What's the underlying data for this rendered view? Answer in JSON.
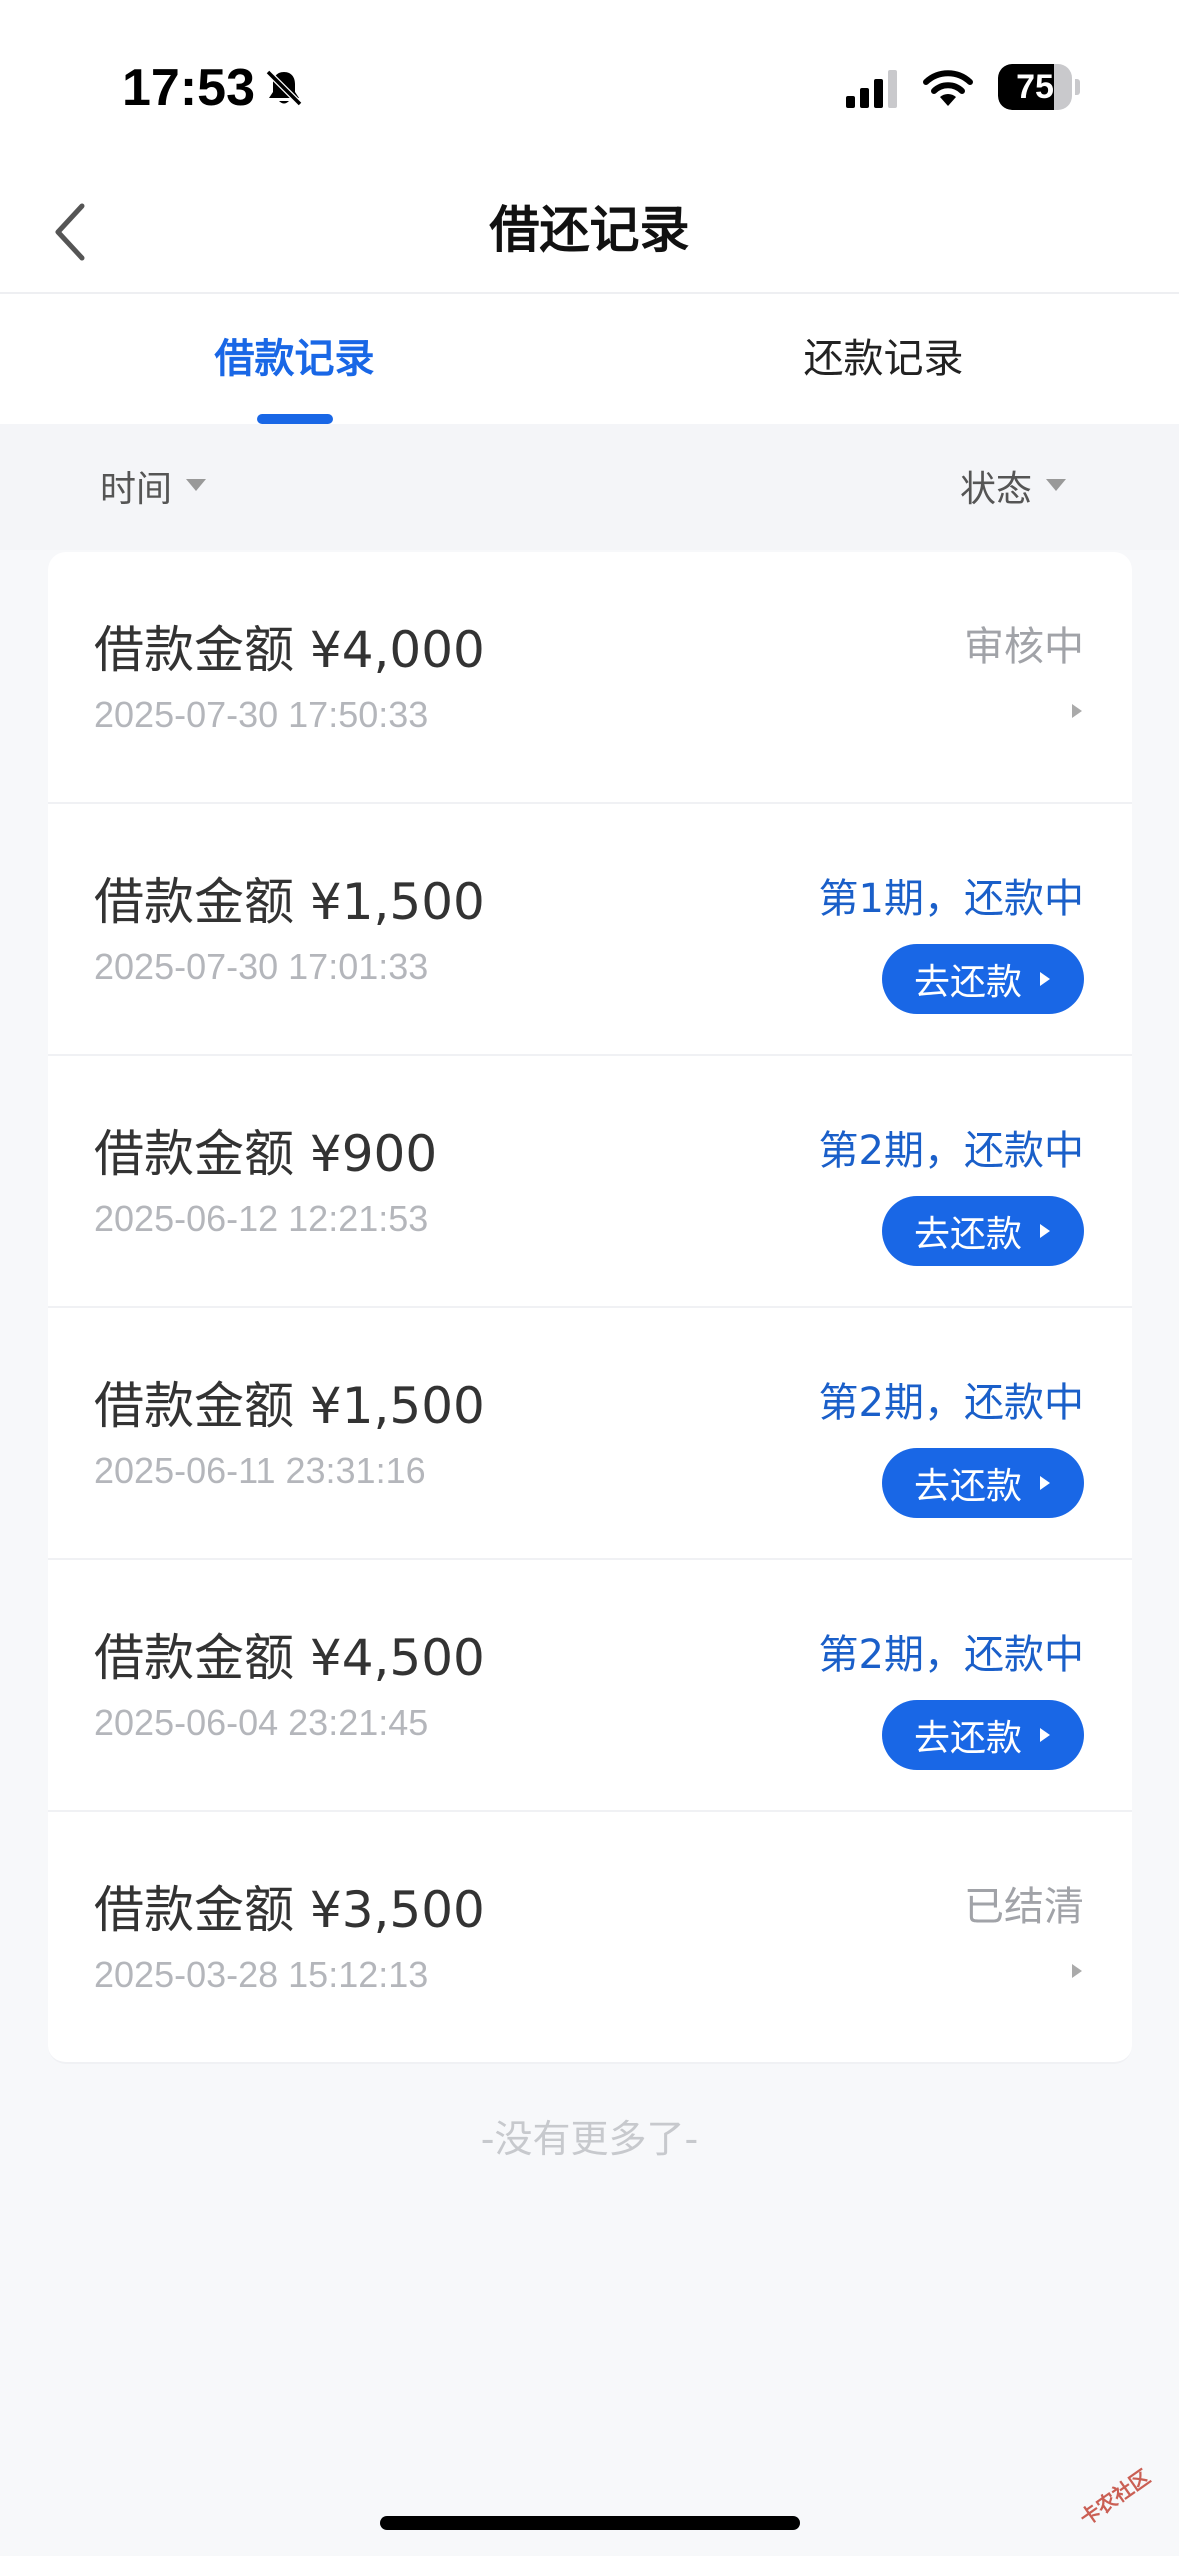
{
  "status_bar": {
    "time": "17:53",
    "battery_level": "75",
    "battery_fraction": 0.75
  },
  "nav": {
    "title": "借还记录"
  },
  "tabs": [
    {
      "label": "借款记录",
      "active": true
    },
    {
      "label": "还款记录",
      "active": false
    }
  ],
  "filters": {
    "time_label": "时间",
    "status_label": "状态"
  },
  "records": [
    {
      "amount": "借款金额 ¥4,000",
      "date": "2025-07-30 17:50:33",
      "status": "审核中",
      "status_color": "gray",
      "action": null
    },
    {
      "amount": "借款金额 ¥1,500",
      "date": "2025-07-30 17:01:33",
      "status": "第1期，还款中",
      "status_color": "blue",
      "action": "去还款"
    },
    {
      "amount": "借款金额 ¥900",
      "date": "2025-06-12 12:21:53",
      "status": "第2期，还款中",
      "status_color": "blue",
      "action": "去还款"
    },
    {
      "amount": "借款金额 ¥1,500",
      "date": "2025-06-11 23:31:16",
      "status": "第2期，还款中",
      "status_color": "blue",
      "action": "去还款"
    },
    {
      "amount": "借款金额 ¥4,500",
      "date": "2025-06-04 23:21:45",
      "status": "第2期，还款中",
      "status_color": "blue",
      "action": "去还款"
    },
    {
      "amount": "借款金额 ¥3,500",
      "date": "2025-03-28 15:12:13",
      "status": "已结清",
      "status_color": "gray",
      "action": null
    }
  ],
  "footer": {
    "no_more": "-没有更多了-"
  },
  "watermark": "卡农社区",
  "colors": {
    "accent": "#1967e6",
    "status_blue": "#1a5fc9",
    "status_gray": "#a1a3a8"
  }
}
